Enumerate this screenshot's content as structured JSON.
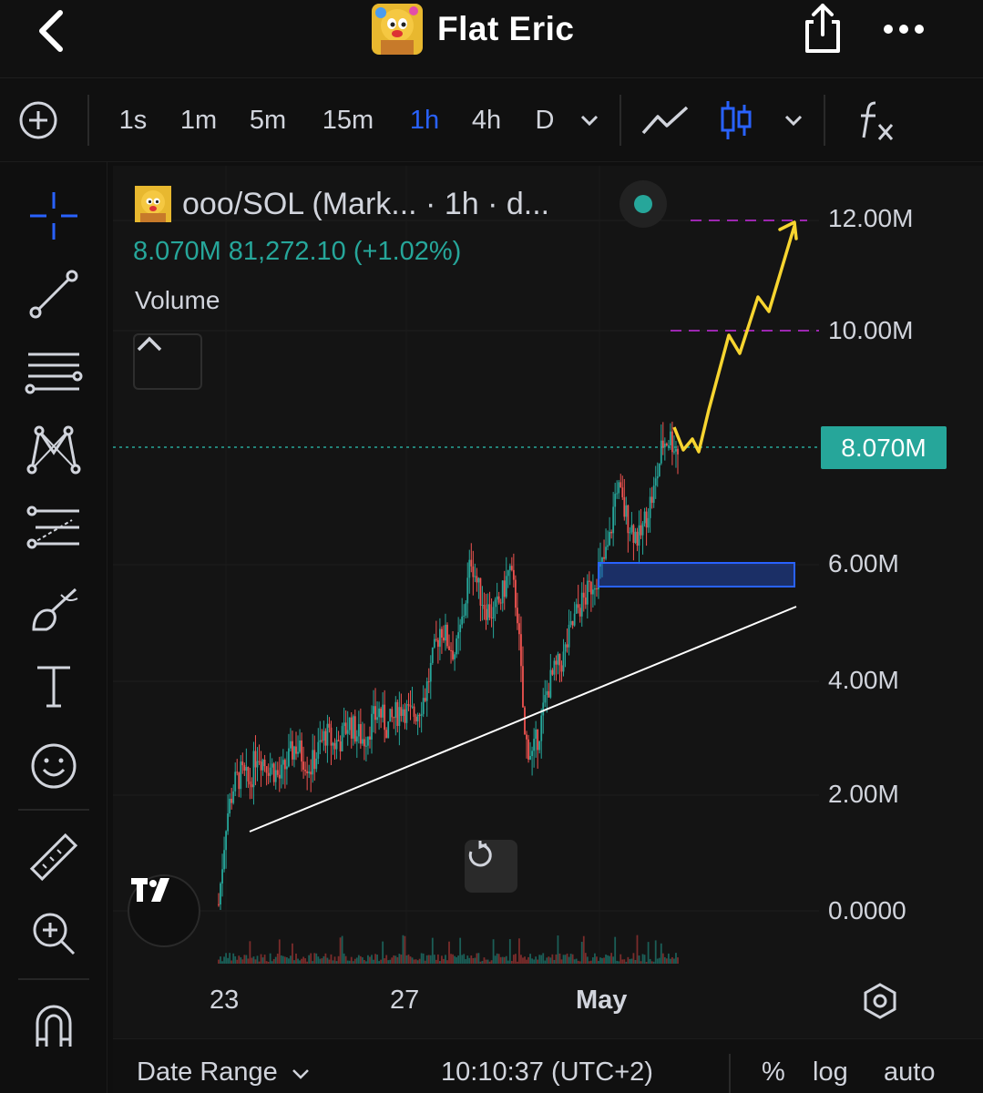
{
  "header": {
    "title": "Flat Eric",
    "back_icon": "chevron-left-icon",
    "share_icon": "share-icon",
    "more_icon": "more-dots-icon"
  },
  "toolbar": {
    "add_icon": "plus-circle-icon",
    "intervals": [
      "1s",
      "1m",
      "5m",
      "15m",
      "1h",
      "4h",
      "D"
    ],
    "active_interval": "1h",
    "interval_dropdown_icon": "chevron-down-icon",
    "line_chart_icon": "line-chart-icon",
    "candles_icon": "candlestick-icon",
    "chart_type_dropdown_icon": "chevron-down-icon",
    "indicators_icon": "fx-icon",
    "accent_color": "#2962ff"
  },
  "left_toolbar": [
    "crosshair-icon",
    "trend-line-icon",
    "horizontal-lines-icon",
    "pattern-icon",
    "fib-icon",
    "brush-icon",
    "text-icon",
    "emoji-icon",
    "ruler-icon",
    "zoom-in-icon",
    "magnet-icon"
  ],
  "legend": {
    "symbol": "ooo/SOL (Mark... · 1h · d...",
    "ohlc": "8.070M  81,272.10 (+1.02%)",
    "volume_label": "Volume",
    "status_color": "#26a69a"
  },
  "price_axis": {
    "labels": [
      "12.00M",
      "10.00M",
      "6.00M",
      "4.00M",
      "2.00M",
      "0.0000"
    ],
    "current_price": "8.070M",
    "current_price_color": "#26a69a"
  },
  "time_axis": {
    "labels": [
      "23",
      "27",
      "May"
    ]
  },
  "bottom_bar": {
    "date_range": "Date Range",
    "time": "10:10:37 (UTC+2)",
    "percent": "%",
    "log": "log",
    "auto": "auto"
  },
  "chart_data": {
    "type": "candlestick",
    "symbol": "ooo/SOL",
    "interval": "1h",
    "x_labels": [
      "23",
      "27",
      "May"
    ],
    "y_ticks": [
      0,
      2000000,
      4000000,
      6000000,
      8070000,
      10000000,
      12000000
    ],
    "close_path": [
      [
        0,
        0.1
      ],
      [
        1,
        1.6
      ],
      [
        2,
        2.2
      ],
      [
        3,
        2.4
      ],
      [
        4,
        2.2
      ],
      [
        5,
        2.8
      ],
      [
        6,
        2.6
      ],
      [
        7,
        2.5
      ],
      [
        8,
        2.3
      ],
      [
        9,
        2.6
      ],
      [
        10,
        2.9
      ],
      [
        11,
        2.7
      ],
      [
        12,
        2.5
      ],
      [
        13,
        2.8
      ],
      [
        14,
        3.1
      ],
      [
        15,
        2.9
      ],
      [
        16,
        3.0
      ],
      [
        17,
        3.3
      ],
      [
        18,
        3.1
      ],
      [
        19,
        3.0
      ],
      [
        20,
        3.3
      ],
      [
        21,
        3.5
      ],
      [
        22,
        3.2
      ],
      [
        23,
        3.4
      ],
      [
        24,
        3.6
      ],
      [
        25,
        3.4
      ],
      [
        26,
        3.5
      ],
      [
        27,
        3.8
      ],
      [
        28,
        4.4
      ],
      [
        29,
        5.0
      ],
      [
        30,
        4.7
      ],
      [
        31,
        4.5
      ],
      [
        32,
        5.2
      ],
      [
        33,
        6.2
      ],
      [
        34,
        5.6
      ],
      [
        35,
        5.3
      ],
      [
        36,
        5.2
      ],
      [
        37,
        5.5
      ],
      [
        38,
        6.0
      ],
      [
        39,
        5.3
      ],
      [
        40,
        3.0
      ],
      [
        41,
        2.7
      ],
      [
        42,
        3.2
      ],
      [
        43,
        3.9
      ],
      [
        44,
        4.2
      ],
      [
        45,
        4.4
      ],
      [
        46,
        4.9
      ],
      [
        47,
        5.3
      ],
      [
        48,
        5.5
      ],
      [
        49,
        5.8
      ],
      [
        50,
        6.0
      ],
      [
        51,
        6.4
      ],
      [
        52,
        7.5
      ],
      [
        53,
        7.0
      ],
      [
        54,
        6.7
      ],
      [
        55,
        6.5
      ],
      [
        56,
        7.0
      ],
      [
        57,
        7.4
      ],
      [
        58,
        8.2
      ],
      [
        59,
        8.3
      ],
      [
        60,
        8.07
      ]
    ],
    "annotations": {
      "trend_line_color": "#ffffff",
      "projection_color": "#f7d530",
      "target_levels_color": "#9c27b0",
      "target_levels": [
        12000000,
        10000000
      ],
      "support_zone": [
        5800000,
        6000000
      ],
      "support_zone_color": "#2962ff"
    }
  }
}
